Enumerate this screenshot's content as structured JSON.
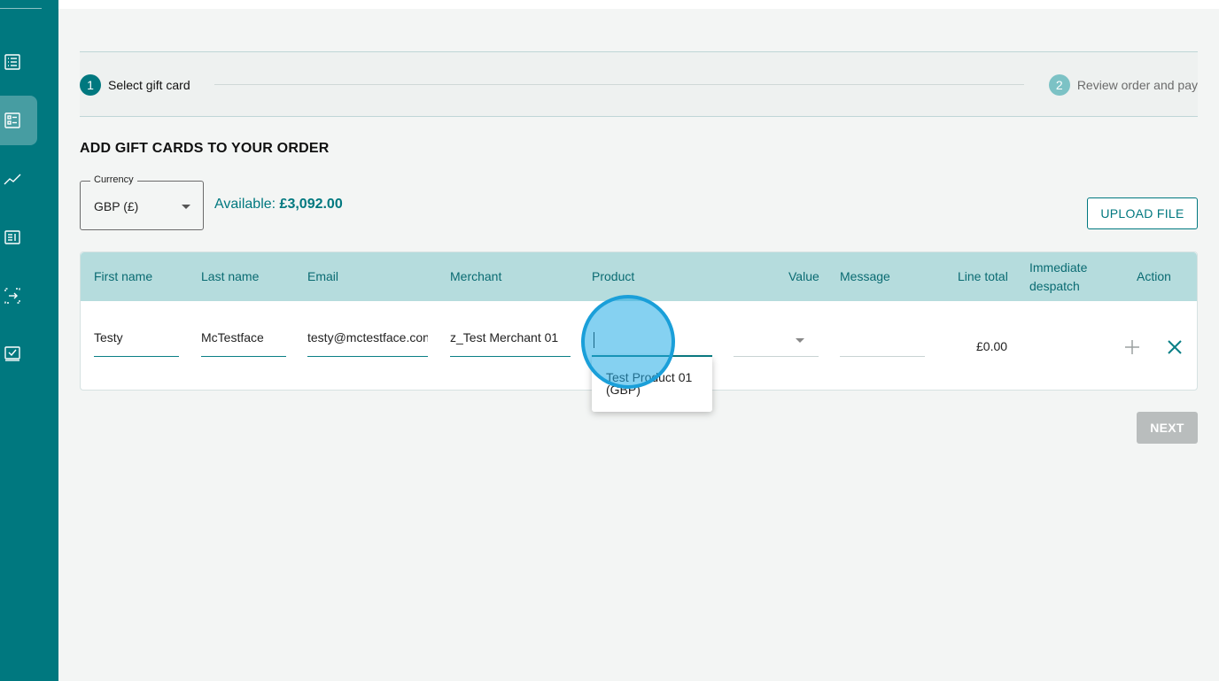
{
  "sidebar": {
    "items": [
      {
        "icon": "list-icon"
      },
      {
        "icon": "checklist-icon"
      },
      {
        "icon": "chart-line-icon"
      },
      {
        "icon": "document-icon"
      },
      {
        "icon": "transfer-icon"
      },
      {
        "icon": "check-square-icon"
      }
    ]
  },
  "stepper": {
    "steps": [
      {
        "number": "1",
        "label": "Select gift card"
      },
      {
        "number": "2",
        "label": "Review order and pay"
      }
    ]
  },
  "section_title": "ADD GIFT CARDS TO YOUR ORDER",
  "currency": {
    "legend": "Currency",
    "value": "GBP (£)"
  },
  "available": {
    "label": "Available:",
    "amount": "£3,092.00"
  },
  "upload_label": "UPLOAD FILE",
  "table": {
    "headers": {
      "first_name": "First name",
      "last_name": "Last name",
      "email": "Email",
      "merchant": "Merchant",
      "product": "Product",
      "value": "Value",
      "message": "Message",
      "line_total": "Line total",
      "immediate_1": "Immediate",
      "immediate_2": "despatch",
      "action": "Action"
    },
    "row": {
      "first_name": "Testy",
      "last_name": "McTestface",
      "email": "testy@mctestface.con",
      "merchant": "z_Test Merchant 01",
      "product": "",
      "value": "",
      "message": "",
      "line_total": "£0.00"
    }
  },
  "product_dropdown": {
    "options": [
      "Test Product 01 (GBP)"
    ]
  },
  "next_label": "NEXT",
  "colors": {
    "brand": "#00787f",
    "header_bg": "#b5dcdd",
    "click_indicator": "#21ace6"
  }
}
